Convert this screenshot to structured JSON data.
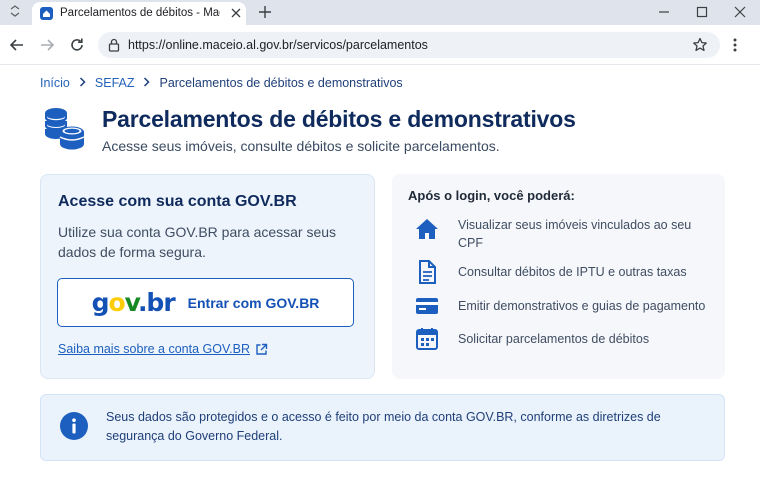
{
  "browser": {
    "tab_title": "Parcelamentos de débitos - Maceió",
    "url": "https://online.maceio.al.gov.br/servicos/parcelamentos"
  },
  "breadcrumb": {
    "items": [
      "Início",
      "SEFAZ",
      "Parcelamentos de débitos e demonstrativos"
    ]
  },
  "page": {
    "title": "Parcelamentos de débitos e demonstrativos",
    "subtitle": "Acesse seus imóveis, consulte débitos e solicite parcelamentos."
  },
  "login_card": {
    "title": "Acesse com sua conta GOV.BR",
    "description": "Utilize sua conta GOV.BR para acessar seus dados de forma segura.",
    "button_logo": "gov.br",
    "button_label": "Entrar com GOV.BR",
    "learn_more": "Saiba mais sobre a conta GOV.BR"
  },
  "features_card": {
    "title": "Após o login, você poderá:",
    "items": [
      {
        "icon": "home-icon",
        "label": "Visualizar seus imóveis vinculados ao seu CPF"
      },
      {
        "icon": "document-icon",
        "label": "Consultar débitos de IPTU e outras taxas"
      },
      {
        "icon": "card-icon",
        "label": "Emitir demonstrativos e guias de pagamento"
      },
      {
        "icon": "calendar-icon",
        "label": "Solicitar parcelamentos de débitos"
      }
    ]
  },
  "info_banner": {
    "text": "Seus dados são protegidos e o acesso é feito por meio da conta GOV.BR, conforme as diretrizes de segurança do Governo Federal."
  },
  "colors": {
    "primary": "#1c5fbf",
    "title": "#0f2a5c",
    "govbr_blue": "#1351b4",
    "govbr_yellow": "#ffcd07",
    "govbr_green": "#168821"
  }
}
